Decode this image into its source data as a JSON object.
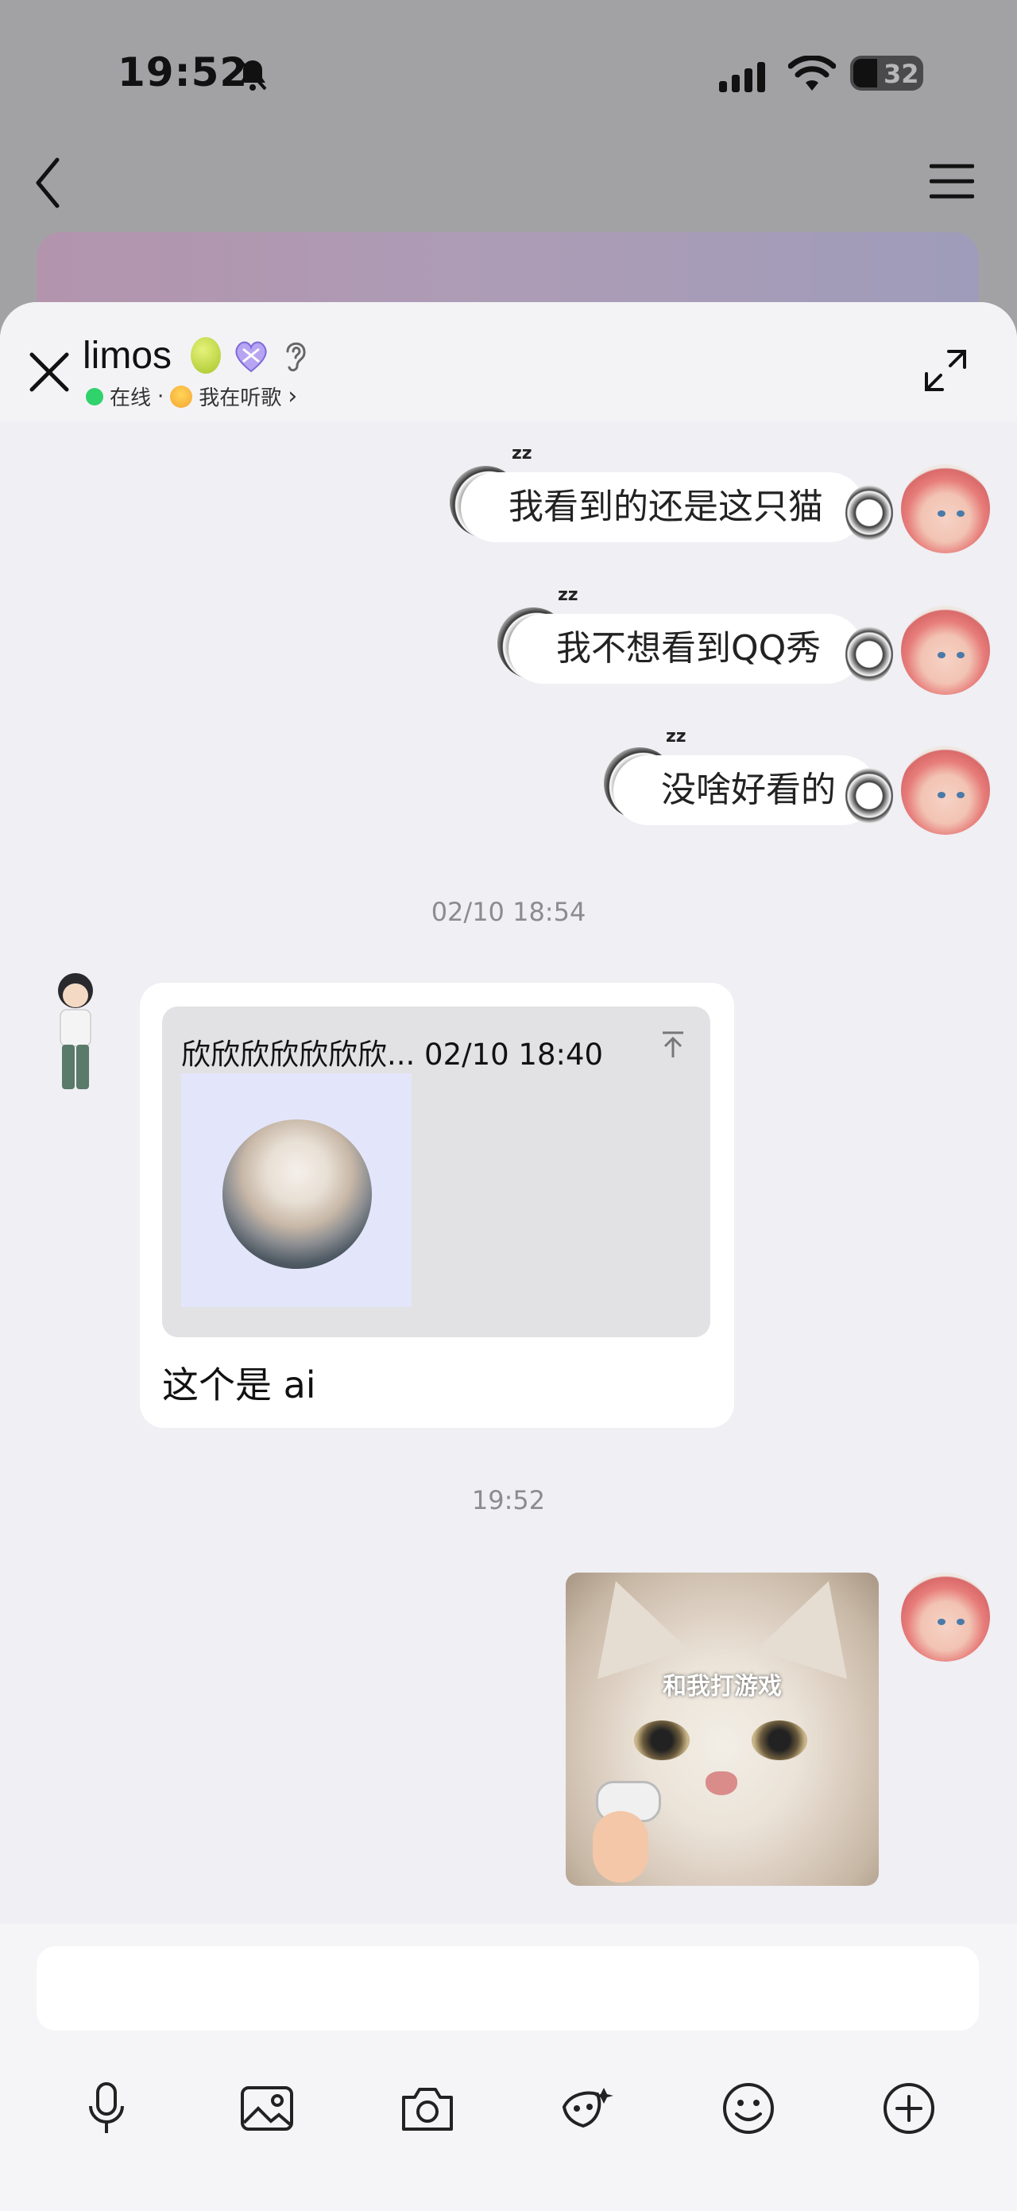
{
  "status_bar": {
    "time": "19:52",
    "battery": "32"
  },
  "chat_header": {
    "name": "limos",
    "presence": "在线",
    "separator": "·",
    "activity": "我在听歌",
    "chevron": "›"
  },
  "messages_top": [
    {
      "text": "我看到的还是这只猫",
      "sender": "me"
    },
    {
      "text": "我不想看到QQ秀",
      "sender": "me"
    },
    {
      "text": "没啥好看的",
      "sender": "me"
    }
  ],
  "timestamp_1": "02/10 18:54",
  "card_message": {
    "quote_title": "欣欣欣欣欣欣欣... 02/10 18:40",
    "text": "这个是 ai"
  },
  "timestamp_2": "19:52",
  "sticker": {
    "caption": "和我打游戏"
  },
  "icons": {
    "toolbar": [
      "microphone-icon",
      "image-icon",
      "camera-icon",
      "mask-icon",
      "emoji-icon",
      "plus-icon"
    ]
  },
  "colors": {
    "online": "#2fd26b",
    "sheet_bg": "#efeff4",
    "accent_card": "#b394ad"
  }
}
